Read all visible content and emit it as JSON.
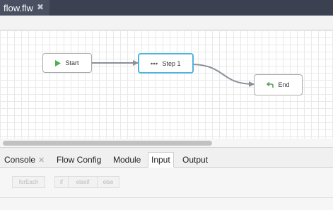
{
  "editor_tab": {
    "label": "flow.flw",
    "close_glyph": "✖"
  },
  "nodes": {
    "start": {
      "label": "Start",
      "icon": "play-icon"
    },
    "step1": {
      "label": "Step 1",
      "icon": "ellipsis-icon"
    },
    "end": {
      "label": "End",
      "icon": "return-arrow-icon"
    }
  },
  "panel_tabs": {
    "console": "Console",
    "console_close": "✕",
    "flow_config": "Flow Config",
    "module": "Module",
    "input": "Input",
    "output": "Output"
  },
  "control_buttons": {
    "foreach": "forEach",
    "if": "if",
    "elseif": "elseif",
    "else": "else"
  },
  "colors": {
    "titlebar": "#3b4150",
    "selected_node_border": "#4fb3de",
    "start_icon": "#4caf50",
    "end_icon": "#5aa05a",
    "edge": "#8a8f99"
  }
}
